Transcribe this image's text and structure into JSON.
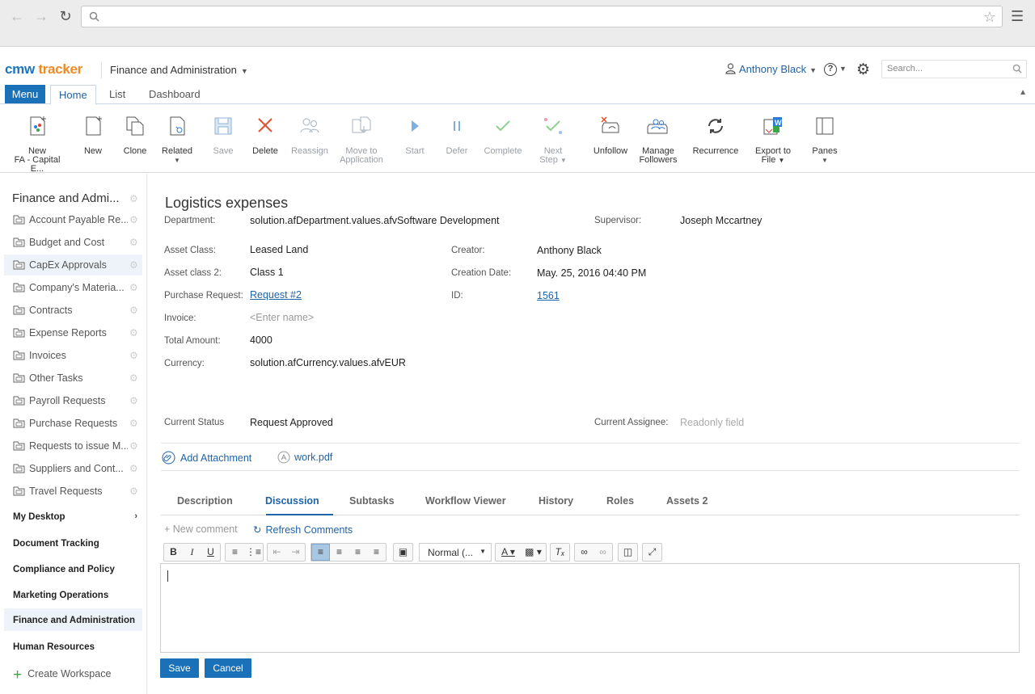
{
  "browser": {
    "address": ""
  },
  "header": {
    "logo_cmw": "cmw",
    "logo_tracker": "tracker",
    "workspace": "Finance and Administration",
    "user": "Anthony Black",
    "search_placeholder": "Search..."
  },
  "ribbon": {
    "menu": "Menu",
    "tabs": [
      "Home",
      "List",
      "Dashboard"
    ]
  },
  "toolbar": {
    "new_fa_line1": "New",
    "new_fa_line2": "FA - Capital E...",
    "new": "New",
    "clone": "Clone",
    "related": "Related",
    "save": "Save",
    "delete": "Delete",
    "reassign": "Reassign",
    "move_line1": "Move to",
    "move_line2": "Application",
    "start": "Start",
    "defer": "Defer",
    "complete": "Complete",
    "next_line1": "Next",
    "next_line2": "Step",
    "unfollow": "Unfollow",
    "manage_line1": "Manage",
    "manage_line2": "Followers",
    "recurrence": "Recurrence",
    "export_line1": "Export to",
    "export_line2": "File",
    "panes": "Panes"
  },
  "sidebar": {
    "title": "Finance and Admi...",
    "items": [
      "Account Payable Re...",
      "Budget and Cost",
      "CapEx Approvals",
      "Company's Materia...",
      "Contracts",
      "Expense Reports",
      "Invoices",
      "Other Tasks",
      "Payroll Requests",
      "Purchase Requests",
      "Requests to issue M...",
      "Suppliers and Cont...",
      "Travel Requests"
    ],
    "sections": [
      "My Desktop",
      "Document Tracking",
      "Compliance and Policy",
      "Marketing Operations",
      "Finance and Administration",
      "Human Resources"
    ],
    "create_workspace": "Create Workspace"
  },
  "record": {
    "title": "Logistics expenses",
    "department_label": "Department:",
    "department_value": "solution.afDepartment.values.afvSoftware Development",
    "supervisor_label": "Supervisor:",
    "supervisor_value": "Joseph Mccartney",
    "asset_class_label": "Asset Class:",
    "asset_class_value": "Leased Land",
    "creator_label": "Creator:",
    "creator_value": "Anthony Black",
    "asset_class2_label": "Asset class 2:",
    "asset_class2_value": "Class 1",
    "creation_date_label": "Creation Date:",
    "creation_date_value": "May. 25, 2016 04:40 PM",
    "purchase_request_label": "Purchase Request:",
    "purchase_request_value": "Request #2",
    "id_label": "ID:",
    "id_value": "1561",
    "invoice_label": "Invoice:",
    "invoice_placeholder": "<Enter name>",
    "total_amount_label": "Total Amount:",
    "total_amount_value": "4000",
    "currency_label": "Currency:",
    "currency_value": "solution.afCurrency.values.afvEUR",
    "status_label": "Current Status",
    "status_value": "Request Approved",
    "assignee_label": "Current Assignee:",
    "assignee_value": "Readonly field"
  },
  "attachments": {
    "add": "Add Attachment",
    "file": "work.pdf"
  },
  "detail_tabs": [
    "Description",
    "Discussion",
    "Subtasks",
    "Workflow Viewer",
    "History",
    "Roles",
    "Assets 2"
  ],
  "comments": {
    "new_comment": "+ New comment",
    "refresh": "Refresh Comments",
    "format": "Normal (...",
    "save": "Save",
    "cancel": "Cancel"
  }
}
